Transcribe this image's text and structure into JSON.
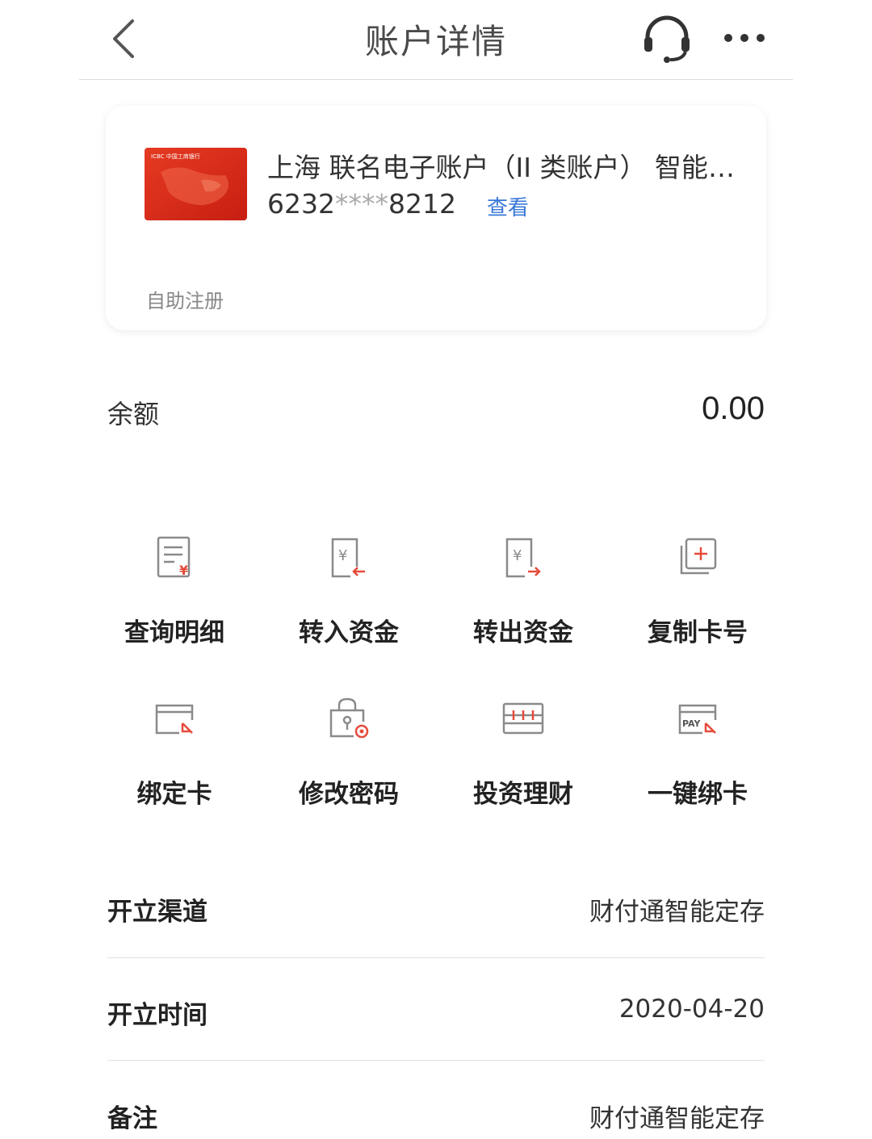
{
  "header": {
    "title": "账户详情",
    "back_icon": "chevron-left-icon",
    "service_icon": "headset-icon",
    "more_icon": "more-dots-icon"
  },
  "account": {
    "name": "上海 联名电子账户（II 类账户） 智能定存",
    "number_prefix": "6232",
    "number_mask": "****",
    "number_suffix": "8212",
    "view_label": "查看",
    "self_register_label": "自助注册",
    "card_brand": "ICBC 中国工商银行"
  },
  "balance": {
    "label": "余额",
    "value": "0.00"
  },
  "actions": [
    {
      "label": "查询明细",
      "icon": "statement-icon"
    },
    {
      "label": "转入资金",
      "icon": "transfer-in-icon"
    },
    {
      "label": "转出资金",
      "icon": "transfer-out-icon"
    },
    {
      "label": "复制卡号",
      "icon": "copy-card-icon"
    },
    {
      "label": "绑定卡",
      "icon": "bind-card-icon"
    },
    {
      "label": "修改密码",
      "icon": "change-password-icon"
    },
    {
      "label": "投资理财",
      "icon": "investment-icon"
    },
    {
      "label": "一键绑卡",
      "icon": "one-click-bind-icon"
    }
  ],
  "info": [
    {
      "key": "开立渠道",
      "value": "财付通智能定存"
    },
    {
      "key": "开立时间",
      "value": "2020-04-20"
    },
    {
      "key": "备注",
      "value": "财付通智能定存"
    }
  ],
  "colors": {
    "accent_red": "#e64a3a",
    "link_blue": "#3978d8",
    "icon_gray": "#8a8a8a"
  }
}
